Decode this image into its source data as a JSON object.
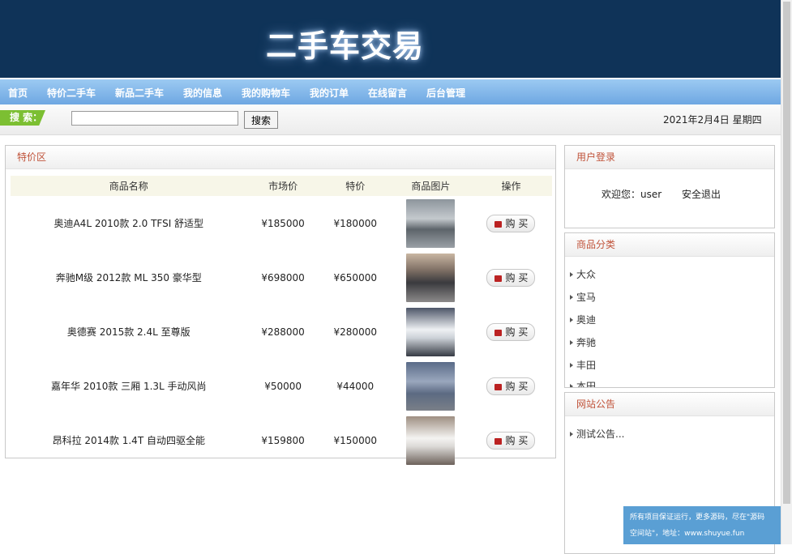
{
  "banner": {
    "title": "二手车交易"
  },
  "nav": {
    "items": [
      "首页",
      "特价二手车",
      "新品二手车",
      "我的信息",
      "我的购物车",
      "我的订单",
      "在线留言",
      "后台管理"
    ]
  },
  "search": {
    "label": "搜 索：",
    "value": "",
    "button": "搜索"
  },
  "date": "2021年2月4日 星期四",
  "special": {
    "title": "特价区",
    "columns": [
      "商品名称",
      "市场价",
      "特价",
      "商品图片",
      "操作"
    ],
    "buy_label": "购 买",
    "items": [
      {
        "name": "奥迪A4L 2010款 2.0 TFSI 舒适型",
        "market": "¥185000",
        "price": "¥180000",
        "img": "audi-sedan-gray"
      },
      {
        "name": "奔驰M级 2012款 ML 350 豪华型",
        "market": "¥698000",
        "price": "¥650000",
        "img": "mercedes-suv-dark"
      },
      {
        "name": "奥德赛 2015款 2.4L 至尊版",
        "market": "¥288000",
        "price": "¥280000",
        "img": "odyssey-mpv-white"
      },
      {
        "name": "嘉年华 2010款 三厢 1.3L 手动风尚",
        "market": "¥50000",
        "price": "¥44000",
        "img": "fiesta-hatch-silver"
      },
      {
        "name": "昂科拉 2014款 1.4T 自动四驱全能",
        "market": "¥159800",
        "price": "¥150000",
        "img": "encore-suv-white"
      }
    ]
  },
  "login": {
    "title": "用户登录",
    "welcome": "欢迎您：user",
    "logout": "安全退出"
  },
  "categories": {
    "title": "商品分类",
    "items": [
      "大众",
      "宝马",
      "奥迪",
      "奔驰",
      "丰田",
      "本田"
    ]
  },
  "notice": {
    "title": "网站公告",
    "items": [
      "测试公告..."
    ]
  },
  "tip": {
    "line1": "所有项目保证运行，更多源码，尽在\"源码",
    "line2": "空间站\"，地址：www.shuyue.fun"
  },
  "colors": {
    "banner": "#0f3358",
    "nav": "#7fb4e8",
    "accent": "#c0533a",
    "search_label": "#7cbf32"
  }
}
